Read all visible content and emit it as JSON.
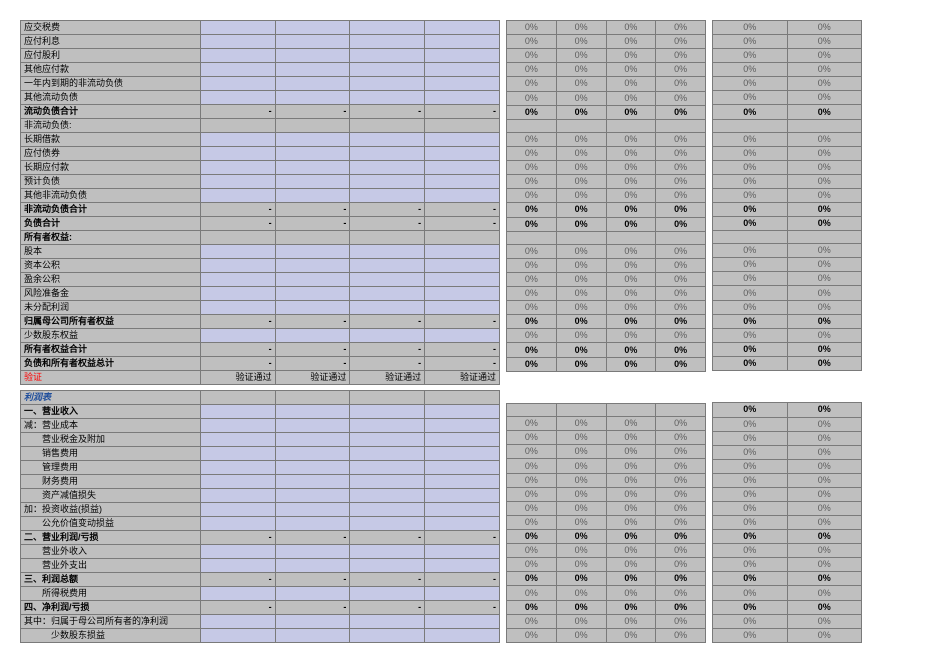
{
  "dash": "-",
  "pct0": "0%",
  "verify_label": "验证",
  "verify_pass": "验证通过",
  "profit_title": "利润表",
  "rows1": [
    {
      "label": "应交税费",
      "bold": false,
      "showDash": false,
      "showPct": true
    },
    {
      "label": "应付利息",
      "bold": false,
      "showDash": false,
      "showPct": true
    },
    {
      "label": "应付股利",
      "bold": false,
      "showDash": false,
      "showPct": true
    },
    {
      "label": "其他应付款",
      "bold": false,
      "showDash": false,
      "showPct": true
    },
    {
      "label": "一年内到期的非流动负债",
      "bold": false,
      "showDash": false,
      "showPct": true
    },
    {
      "label": "其他流动负债",
      "bold": false,
      "showDash": false,
      "showPct": true
    },
    {
      "label": "流动负债合计",
      "bold": true,
      "showDash": true,
      "showPct": true
    },
    {
      "label": "非流动负债:",
      "bold": false,
      "showDash": false,
      "showPct": false,
      "noPct": true
    },
    {
      "label": "长期借款",
      "bold": false,
      "showDash": false,
      "showPct": true
    },
    {
      "label": "应付债券",
      "bold": false,
      "showDash": false,
      "showPct": true
    },
    {
      "label": "长期应付款",
      "bold": false,
      "showDash": false,
      "showPct": true
    },
    {
      "label": "预计负债",
      "bold": false,
      "showDash": false,
      "showPct": true
    },
    {
      "label": "其他非流动负债",
      "bold": false,
      "showDash": false,
      "showPct": true
    },
    {
      "label": "非流动负债合计",
      "bold": true,
      "showDash": true,
      "showPct": true
    },
    {
      "label": "负债合计",
      "bold": true,
      "showDash": true,
      "showPct": true
    },
    {
      "label": "所有者权益:",
      "bold": true,
      "showDash": false,
      "showPct": false,
      "noPct": true
    },
    {
      "label": "股本",
      "bold": false,
      "showDash": false,
      "showPct": true
    },
    {
      "label": "资本公积",
      "bold": false,
      "showDash": false,
      "showPct": true
    },
    {
      "label": "盈余公积",
      "bold": false,
      "showDash": false,
      "showPct": true
    },
    {
      "label": "风险准备金",
      "bold": false,
      "showDash": false,
      "showPct": true
    },
    {
      "label": "未分配利润",
      "bold": false,
      "showDash": false,
      "showPct": true
    },
    {
      "label": "归属母公司所有者权益",
      "bold": true,
      "showDash": true,
      "showPct": true
    },
    {
      "label": "少数股东权益",
      "bold": false,
      "showDash": false,
      "showPct": true
    },
    {
      "label": "所有者权益合计",
      "bold": true,
      "showDash": true,
      "showPct": true
    },
    {
      "label": "负债和所有者权益总计",
      "bold": true,
      "showDash": true,
      "showPct": true
    }
  ],
  "rows2": [
    {
      "label": "一、营业收入",
      "bold": true,
      "showDash": false,
      "showPct": true,
      "noMidPct": true
    },
    {
      "label": "减：营业成本",
      "bold": false,
      "showDash": false,
      "showPct": true
    },
    {
      "label": "　　营业税金及附加",
      "bold": false,
      "showDash": false,
      "showPct": true
    },
    {
      "label": "　　销售费用",
      "bold": false,
      "showDash": false,
      "showPct": true
    },
    {
      "label": "　　管理费用",
      "bold": false,
      "showDash": false,
      "showPct": true
    },
    {
      "label": "　　财务费用",
      "bold": false,
      "showDash": false,
      "showPct": true
    },
    {
      "label": "　　资产减值损失",
      "bold": false,
      "showDash": false,
      "showPct": true
    },
    {
      "label": "加：投资收益(损益)",
      "bold": false,
      "showDash": false,
      "showPct": true
    },
    {
      "label": "　　公允价值变动损益",
      "bold": false,
      "showDash": false,
      "showPct": true
    },
    {
      "label": "二、营业利润/亏损",
      "bold": true,
      "showDash": true,
      "showPct": true
    },
    {
      "label": "　　营业外收入",
      "bold": false,
      "showDash": false,
      "showPct": true
    },
    {
      "label": "　　营业外支出",
      "bold": false,
      "showDash": false,
      "showPct": true
    },
    {
      "label": "三、利润总额",
      "bold": true,
      "showDash": true,
      "showPct": true
    },
    {
      "label": "　　所得税费用",
      "bold": false,
      "showDash": false,
      "showPct": true
    },
    {
      "label": "四、净利润/亏损",
      "bold": true,
      "showDash": true,
      "showPct": true
    },
    {
      "label": "其中：归属于母公司所有者的净利润",
      "bold": false,
      "showDash": false,
      "showPct": true
    },
    {
      "label": "　　　少数股东损益",
      "bold": false,
      "showDash": false,
      "showPct": true
    }
  ]
}
